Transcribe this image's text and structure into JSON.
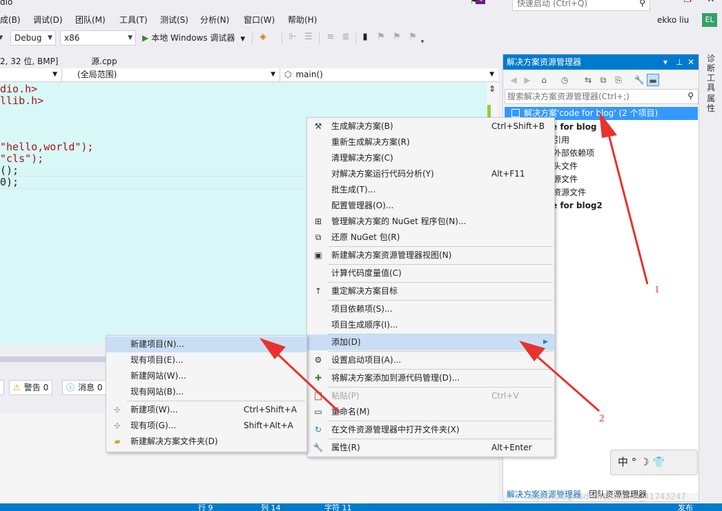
{
  "menubar": {
    "title_fragment": "dio",
    "items": [
      "成(B)",
      "调试(D)",
      "团队(M)",
      "工具(T)",
      "测试(S)",
      "分析(N)",
      "窗口(W)",
      "帮助(H)"
    ],
    "notification_count": "4",
    "quick_launch_placeholder": "快速启动 (Ctrl+Q)",
    "user_name": "ekko liu",
    "user_initials": "EL"
  },
  "toolbar": {
    "config": "Debug",
    "platform": "x86",
    "run_label": "本地 Windows 调试器"
  },
  "editor": {
    "doc_tabs": [
      "2, 32 位, BMP]",
      "源.cpp"
    ],
    "nav_scope": "(全局范围)",
    "nav_member": "main()",
    "lines": [
      "dio.h>",
      "llib.h>",
      "",
      "",
      "",
      "\"hello,world\");",
      "\"cls\");",
      "();",
      "0);"
    ]
  },
  "error_list": {
    "warnings": "警告 0",
    "messages": "消息 0"
  },
  "solution_explorer": {
    "title": "解决方案资源管理器",
    "search_placeholder": "搜索解决方案资源管理器(Ctrl+;)",
    "tree": [
      "解决方案'code for blog' (2 个项目)",
      "e for blog",
      "引用",
      "外部依赖项",
      "头文件",
      "源文件",
      "资源文件",
      "e for blog2"
    ],
    "bottom_tabs": [
      "解决方案资源管理器",
      "团队资源管理器"
    ]
  },
  "side_tabs": [
    "诊断工具",
    "属性"
  ],
  "ime_bar": "中 ° ☽ 👕",
  "watermark": "https://blog.csdn.net/weixin_41743247",
  "statusbar": [
    "行 9",
    "列 14",
    "字符 11",
    "发布"
  ],
  "context_menu": {
    "items": [
      {
        "label": "生成解决方案(B)",
        "shortcut": "Ctrl+Shift+B",
        "icon": "build-icon"
      },
      {
        "label": "重新生成解决方案(R)",
        "shortcut": ""
      },
      {
        "label": "清理解决方案(C)",
        "shortcut": ""
      },
      {
        "label": "对解决方案运行代码分析(Y)",
        "shortcut": "Alt+F11"
      },
      {
        "label": "批生成(T)...",
        "shortcut": ""
      },
      {
        "label": "配置管理器(O)...",
        "shortcut": ""
      },
      {
        "label": "管理解决方案的 NuGet 程序包(N)...",
        "shortcut": "",
        "icon": "nuget-icon"
      },
      {
        "label": "还原 NuGet 包(R)",
        "shortcut": "",
        "icon": "restore-icon"
      },
      {
        "label": "新建解决方案资源管理器视图(N)",
        "shortcut": "",
        "icon": "new-view-icon"
      },
      {
        "label": "计算代码度量值(C)",
        "shortcut": ""
      },
      {
        "label": "重定解决方案目标",
        "shortcut": "",
        "icon": "retarget-icon"
      },
      {
        "label": "项目依赖项(S)...",
        "shortcut": ""
      },
      {
        "label": "项目生成顺序(I)...",
        "shortcut": ""
      },
      {
        "label": "添加(D)",
        "shortcut": "",
        "submenu": true
      },
      {
        "label": "设置启动项目(A)...",
        "shortcut": "",
        "icon": "gear-icon"
      },
      {
        "label": "将解决方案添加到源代码管理(D)...",
        "shortcut": "",
        "icon": "source-control-icon"
      },
      {
        "label": "粘贴(P)",
        "shortcut": "Ctrl+V",
        "disabled": true,
        "icon": "paste-icon"
      },
      {
        "label": "重命名(M)",
        "shortcut": "",
        "icon": "rename-icon"
      },
      {
        "label": "在文件资源管理器中打开文件夹(X)",
        "shortcut": "",
        "icon": "open-folder-icon"
      },
      {
        "label": "属性(R)",
        "shortcut": "Alt+Enter",
        "icon": "wrench-icon"
      }
    ]
  },
  "sub_menu": {
    "items": [
      {
        "label": "新建项目(N)...",
        "shortcut": ""
      },
      {
        "label": "现有项目(E)...",
        "shortcut": ""
      },
      {
        "label": "新建网站(W)...",
        "shortcut": ""
      },
      {
        "label": "现有网站(B)...",
        "shortcut": ""
      },
      {
        "label": "新建项(W)...",
        "shortcut": "Ctrl+Shift+A",
        "icon": "new-item-icon"
      },
      {
        "label": "现有项(G)...",
        "shortcut": "Shift+Alt+A",
        "icon": "existing-item-icon"
      },
      {
        "label": "新建解决方案文件夹(D)",
        "shortcut": "",
        "icon": "solution-folder-icon"
      }
    ]
  },
  "annotations": [
    "1",
    "2"
  ]
}
